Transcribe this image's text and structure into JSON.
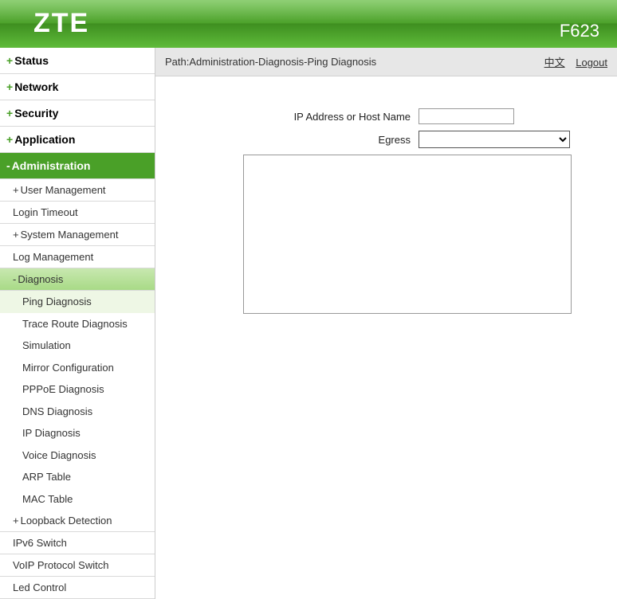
{
  "brand": "ZTE",
  "model": "F623",
  "path_label": "Path:Administration-Diagnosis-Ping Diagnosis",
  "lang_link": "中文",
  "logout_link": "Logout",
  "sidebar": {
    "status": "Status",
    "network": "Network",
    "security": "Security",
    "application": "Application",
    "administration": "Administration",
    "user_mgmt": "User Management",
    "login_timeout": "Login Timeout",
    "system_mgmt": "System Management",
    "log_mgmt": "Log Management",
    "diagnosis": "Diagnosis",
    "ping_diag": "Ping Diagnosis",
    "trace_diag": "Trace Route Diagnosis",
    "simulation": "Simulation",
    "mirror": "Mirror Configuration",
    "pppoe": "PPPoE Diagnosis",
    "dns": "DNS Diagnosis",
    "ip": "IP Diagnosis",
    "voice": "Voice Diagnosis",
    "arp": "ARP Table",
    "mac": "MAC Table",
    "loopback": "Loopback Detection",
    "ipv6": "IPv6 Switch",
    "voip": "VoIP Protocol Switch",
    "led": "Led Control"
  },
  "form": {
    "ip_label": "IP Address or Host Name",
    "ip_value": "",
    "egress_label": "Egress",
    "egress_value": ""
  }
}
